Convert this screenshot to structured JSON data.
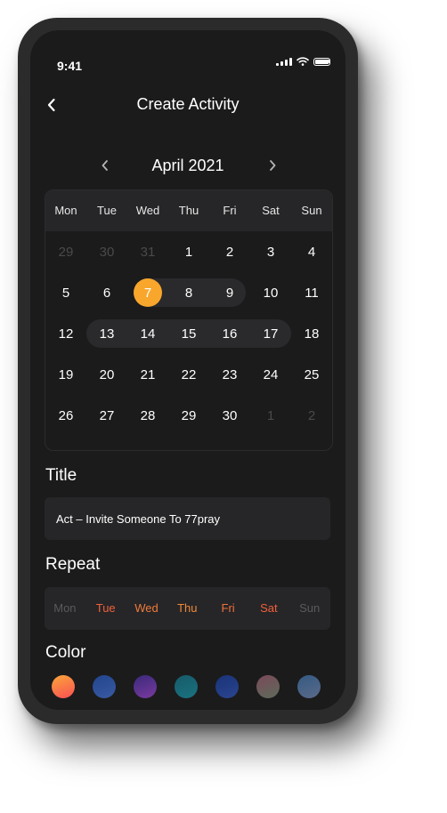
{
  "status": {
    "time": "9:41"
  },
  "header": {
    "title": "Create Activity"
  },
  "calendar": {
    "month_label": "April 2021",
    "weekdays": [
      "Mon",
      "Tue",
      "Wed",
      "Thu",
      "Fri",
      "Sat",
      "Sun"
    ],
    "weeks": [
      [
        "29",
        "30",
        "31",
        "1",
        "2",
        "3",
        "4"
      ],
      [
        "5",
        "6",
        "7",
        "8",
        "9",
        "10",
        "11"
      ],
      [
        "12",
        "13",
        "14",
        "15",
        "16",
        "17",
        "18"
      ],
      [
        "19",
        "20",
        "21",
        "22",
        "23",
        "24",
        "25"
      ],
      [
        "26",
        "27",
        "28",
        "29",
        "30",
        "1",
        "2"
      ]
    ],
    "selected_day": "7",
    "accent": "#F8A72C"
  },
  "title_section": {
    "label": "Title",
    "value": "Act – Invite Someone To 77pray"
  },
  "repeat_section": {
    "label": "Repeat",
    "days": [
      {
        "label": "Mon",
        "active": false,
        "color": "#5a5a5c"
      },
      {
        "label": "Tue",
        "active": true,
        "color": "#F0603A"
      },
      {
        "label": "Wed",
        "active": true,
        "color": "#F07A3A"
      },
      {
        "label": "Thu",
        "active": true,
        "color": "#F0883A"
      },
      {
        "label": "Fri",
        "active": true,
        "color": "#F0703A"
      },
      {
        "label": "Sat",
        "active": true,
        "color": "#F0603A"
      },
      {
        "label": "Sun",
        "active": false,
        "color": "#5a5a5c"
      }
    ]
  },
  "color_section": {
    "label": "Color",
    "swatches": [
      {
        "name": "orange-gradient",
        "from": "#F9A63A",
        "to": "#FB4F54"
      },
      {
        "name": "blue",
        "from": "#22458e",
        "to": "#3a5aa2"
      },
      {
        "name": "purple",
        "from": "#3a2a7a",
        "to": "#7a3aa0"
      },
      {
        "name": "teal",
        "from": "#175a6a",
        "to": "#1a7380"
      },
      {
        "name": "navy",
        "from": "#1a3378",
        "to": "#2a4590"
      },
      {
        "name": "mauve",
        "from": "#7a4a5a",
        "to": "#5e6a5a"
      },
      {
        "name": "slate",
        "from": "#355a82",
        "to": "#5a6a8a"
      }
    ]
  }
}
